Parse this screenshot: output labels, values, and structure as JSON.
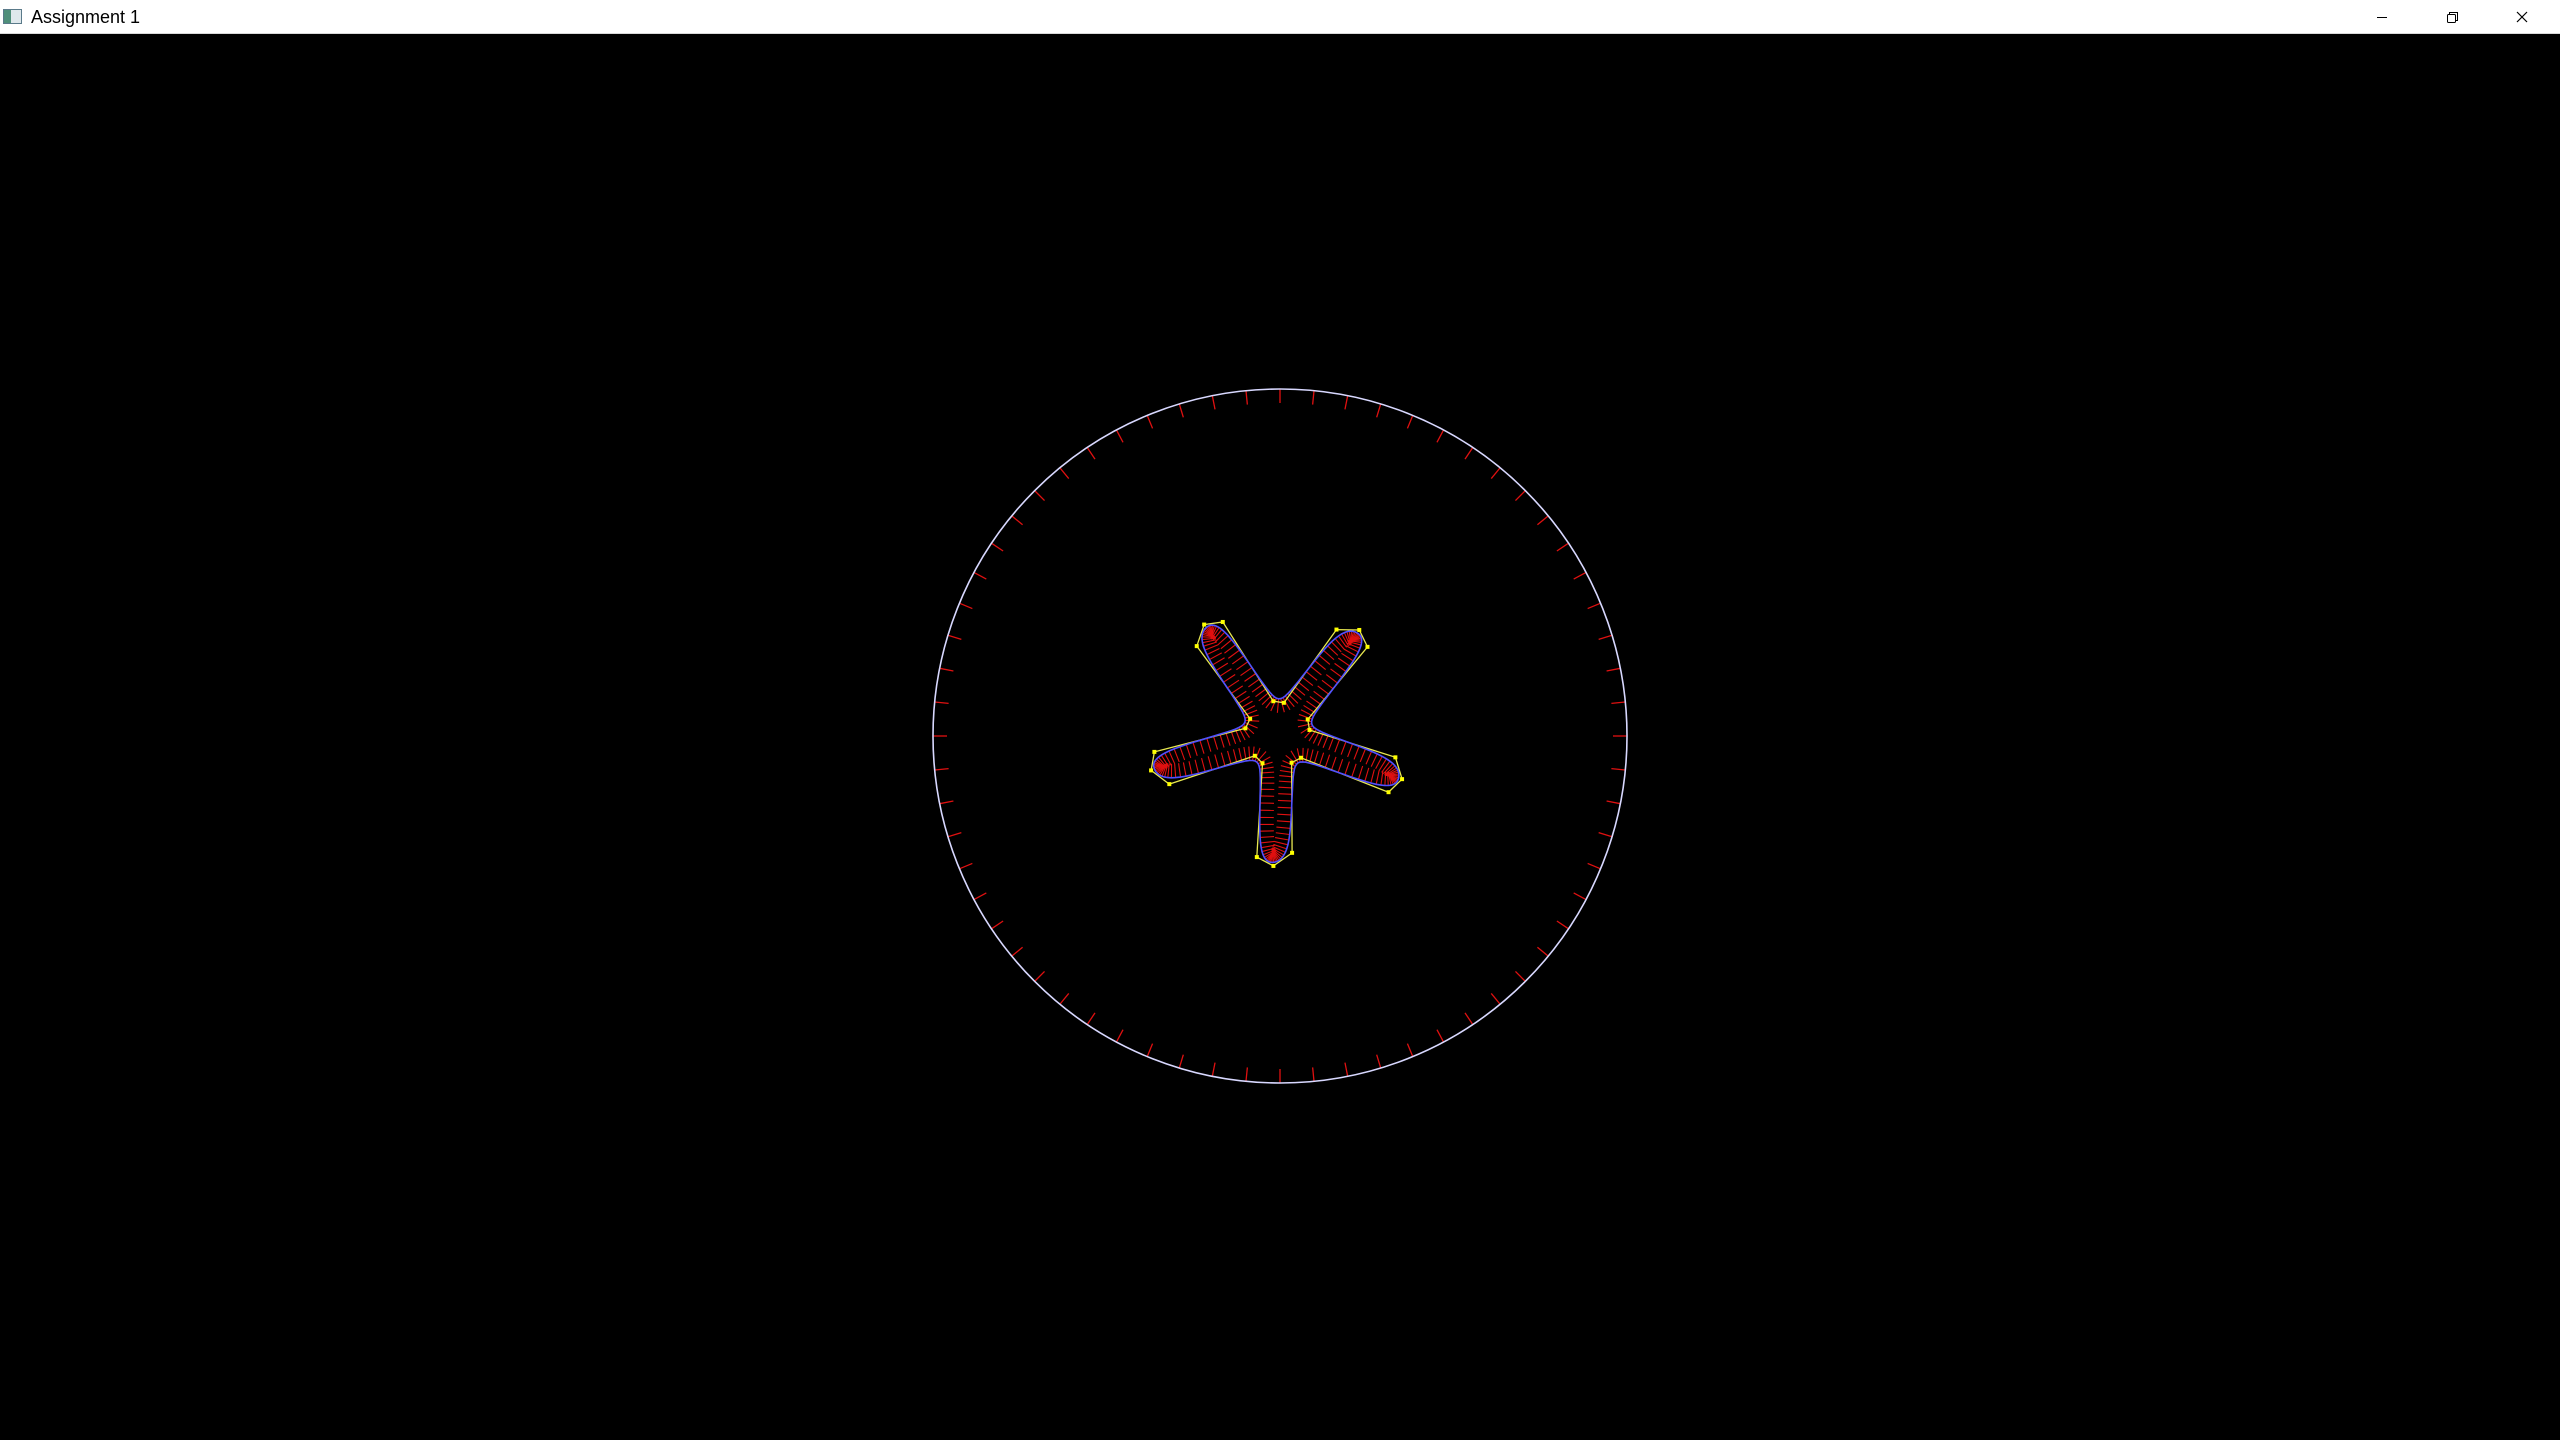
{
  "window": {
    "title": "Assignment 1",
    "controls": {
      "minimize": "minimize-icon",
      "maximize": "restore-icon",
      "close": "close-icon"
    }
  },
  "scene": {
    "background_color": "#000000",
    "outer_curve": {
      "description_color_curve": "#d8d8ff",
      "normal_color": "#e01010",
      "normal_count": 64
    },
    "star_shape": {
      "petals": 5,
      "curve_color": "#5050ff",
      "control_polygon_color": "#e8e850",
      "control_point_color": "#ffff00",
      "normal_color": "#e01010"
    }
  }
}
